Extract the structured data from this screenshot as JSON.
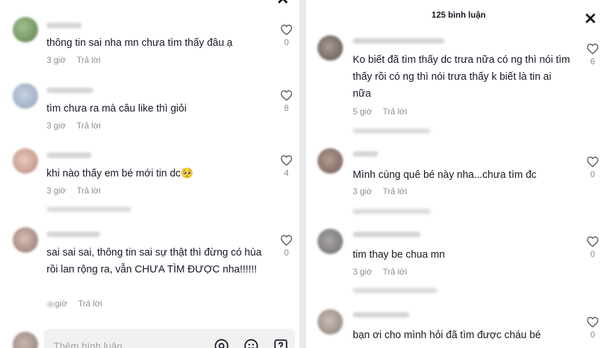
{
  "left_panel": {
    "comments": [
      {
        "text": "thông tin sai nha mn chưa tìm thấy đâu ạ",
        "time": "3 giờ",
        "reply": "Trả lời",
        "likes": "0"
      },
      {
        "text": "tìm chưa ra mà câu like thì giỏi",
        "time": "3 giờ",
        "reply": "Trả lời",
        "likes": "8"
      },
      {
        "text": "khi nào thấy em bé mới tin dc🥺",
        "time": "3 giờ",
        "reply": "Trả lời",
        "likes": "4"
      },
      {
        "text": "sai sai sai, thông tin sai sự thật thì đừng có hùa rồi lan rộng ra, vẫn CHƯA TÌM ĐƯỢC nha!!!!!!",
        "time": "giờ",
        "reply": "Trả lời",
        "likes": "0"
      }
    ],
    "input": {
      "placeholder": "Thêm bình luận..."
    }
  },
  "right_panel": {
    "title": "125 bình luận",
    "comments": [
      {
        "text": "Ko biết đã tìm thấy dc trưa nữa có ng thì nói tìm thấy rồi có ng thì nói trưa thấy k biết là tin ai nữa",
        "time": "5 giờ",
        "reply": "Trả lời",
        "likes": "6"
      },
      {
        "text": "Mình cùng quê bé này nha...chưa tìm đc",
        "time": "3 giờ",
        "reply": "Trả lời",
        "likes": "0"
      },
      {
        "text": "tim thay be chua mn",
        "time": "3 giờ",
        "reply": "Trả lời",
        "likes": "0"
      },
      {
        "text": "bạn ơi cho mình hỏi đã tìm được cháu bé",
        "time": "",
        "reply": "",
        "likes": "0"
      }
    ]
  },
  "icons": {
    "close": "close-icon",
    "like": "heart-outline-icon",
    "mention": "at-icon",
    "emoji": "emoji-icon",
    "gif": "gif-icon"
  },
  "colors": {
    "text": "#161823",
    "muted": "#8a8b91",
    "input_bg": "#f1f1f2"
  }
}
